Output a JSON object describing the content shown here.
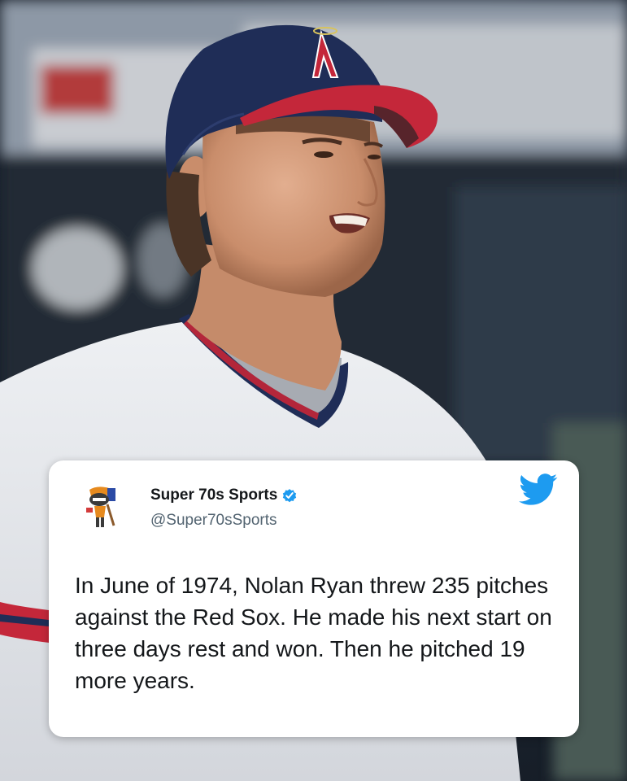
{
  "photo": {
    "subject": "baseball player in Angels cap and jersey",
    "cap_color": "#1f2d57",
    "brim_color": "#c4273a",
    "jersey_color": "#e7e8ec"
  },
  "tweet": {
    "display_name": "Super 70s Sports",
    "handle": "@Super70sSports",
    "text": "In June of 1974, Nolan Ryan threw 235 pitches against the Red Sox. He made his next start on three days rest and won. Then he pitched 19 more years.",
    "verified_icon": "verified-badge-icon",
    "brand_icon": "twitter-bird-icon",
    "brand_color": "#1d9bf0"
  }
}
